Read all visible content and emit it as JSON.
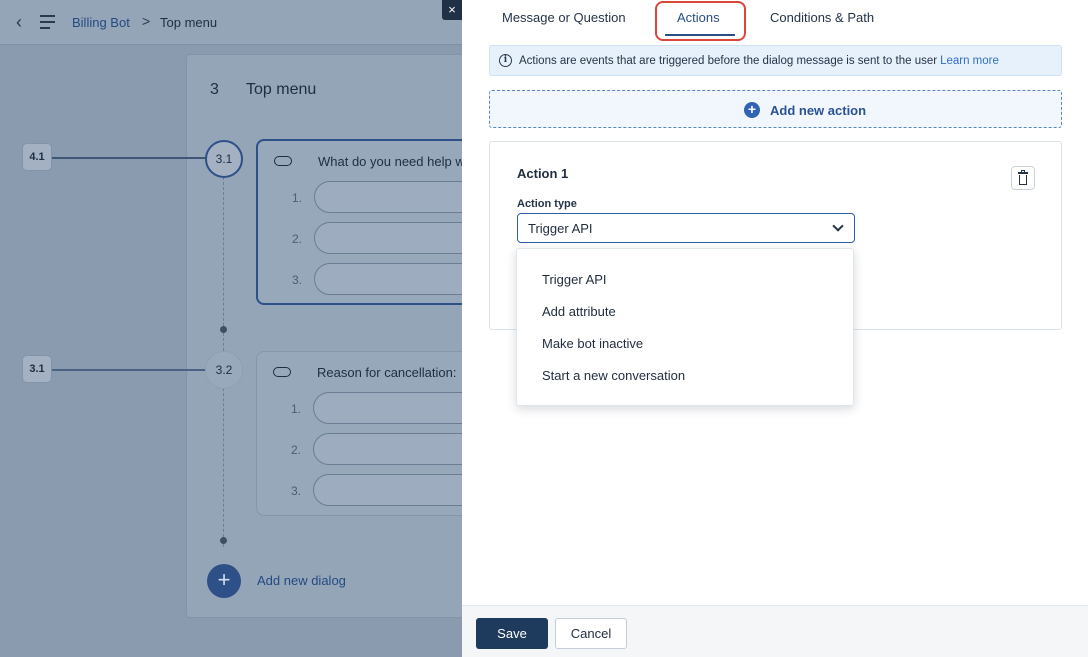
{
  "breadcrumb": {
    "bot": "Billing Bot",
    "separator": ">",
    "current": "Top menu"
  },
  "icons": {
    "back": "‹",
    "close": "×"
  },
  "canvas": {
    "header_number": "3",
    "header_title": "Top menu",
    "side_badges": [
      "4.1",
      "3.1"
    ],
    "dialogs": [
      {
        "number": "3.1",
        "question": "What do you need help w",
        "rows": [
          "1.",
          "2.",
          "3."
        ]
      },
      {
        "number": "3.2",
        "question": "Reason for cancellation:",
        "rows": [
          "1.",
          "2.",
          "3."
        ]
      }
    ],
    "add_button_glyph": "+",
    "add_dialog_label": "Add new dialog"
  },
  "tabs": [
    {
      "label": "Message or Question",
      "active": false
    },
    {
      "label": "Actions",
      "active": true
    },
    {
      "label": "Conditions & Path",
      "active": false
    }
  ],
  "info": {
    "icon": "i",
    "text": "Actions are events that are triggered before the dialog message is sent to the user",
    "link": "Learn more"
  },
  "add_action": {
    "icon": "+",
    "label": "Add new action"
  },
  "action": {
    "title": "Action 1",
    "type_label": "Action type",
    "selected": "Trigger API",
    "options": [
      "Trigger API",
      "Add attribute",
      "Make bot inactive",
      "Start a new conversation"
    ]
  },
  "footer": {
    "save": "Save",
    "cancel": "Cancel"
  },
  "colors": {
    "primary": "#1e3a5c",
    "accent": "#2f63b3",
    "highlight": "#d9473a",
    "overlay": "#8a9bb0"
  }
}
